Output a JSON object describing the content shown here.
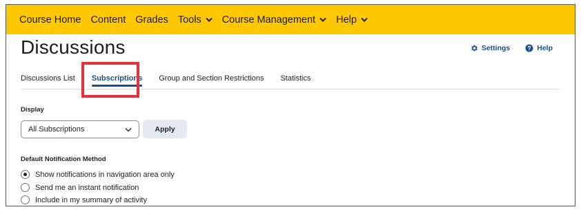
{
  "navbar": {
    "items": [
      {
        "label": "Course Home",
        "dropdown": false
      },
      {
        "label": "Content",
        "dropdown": false
      },
      {
        "label": "Grades",
        "dropdown": false
      },
      {
        "label": "Tools",
        "dropdown": true
      },
      {
        "label": "Course Management",
        "dropdown": true
      },
      {
        "label": "Help",
        "dropdown": true
      }
    ]
  },
  "page": {
    "title": "Discussions",
    "settings_label": "Settings",
    "help_label": "Help"
  },
  "tabs": [
    {
      "label": "Discussions List",
      "active": false
    },
    {
      "label": "Subscriptions",
      "active": true
    },
    {
      "label": "Group and Section Restrictions",
      "active": false
    },
    {
      "label": "Statistics",
      "active": false
    }
  ],
  "display": {
    "label": "Display",
    "selected": "All Subscriptions",
    "apply_label": "Apply"
  },
  "notification": {
    "label": "Default Notification Method",
    "options": [
      {
        "label": "Show notifications in navigation area only",
        "checked": true
      },
      {
        "label": "Send me an instant notification",
        "checked": false
      },
      {
        "label": "Include in my summary of activity",
        "checked": false
      }
    ]
  },
  "colors": {
    "navbar_bg": "#fdc800",
    "link_blue": "#1a4f8a",
    "highlight_red": "#e8303b"
  }
}
